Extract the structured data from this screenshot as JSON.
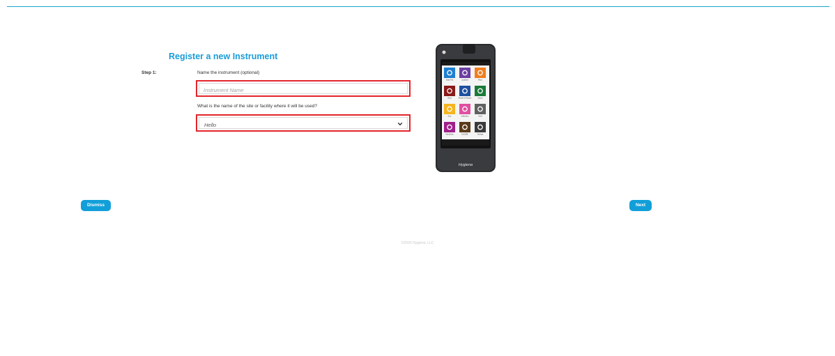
{
  "form": {
    "title": "Register a new Instrument",
    "step_label": "Step 1:",
    "name_question": "Name the instrument (optional)",
    "name_placeholder": "Instrument Name",
    "site_question": "What is the name of the site or facility where it will be used?",
    "site_selected": "Hello"
  },
  "device": {
    "brand": "Hygiena",
    "tiles": [
      {
        "label": "Swab Test",
        "icon": "lightning-icon",
        "color": "#1f7fd0"
      },
      {
        "label": "Locations",
        "icon": "location-pin-icon",
        "color": "#6c3fa0"
      },
      {
        "label": "Plans",
        "icon": "list-icon",
        "color": "#f07e1f"
      },
      {
        "label": "Users",
        "icon": "user-icon",
        "color": "#8b1a1a"
      },
      {
        "label": "Results & Reports",
        "icon": "pie-chart-icon",
        "color": "#1f4fa0"
      },
      {
        "label": "Search",
        "icon": "search-icon",
        "color": "#1a7a3a"
      },
      {
        "label": "Sync",
        "icon": "sync-icon",
        "color": "#f5b520"
      },
      {
        "label": "Calibration",
        "icon": "check-icon",
        "color": "#e04fa0"
      },
      {
        "label": "Verify",
        "icon": "verify-icon",
        "color": "#606060"
      },
      {
        "label": "MicroSnap",
        "icon": "microsnap-icon",
        "color": "#a0208a"
      },
      {
        "label": "EnSURE",
        "icon": "dots-icon",
        "color": "#5a3a1a"
      },
      {
        "label": "Settings",
        "icon": "gear-icon",
        "color": "#3a3a3a"
      }
    ]
  },
  "buttons": {
    "dismiss": "Dismiss",
    "next": "Next"
  },
  "footer": {
    "copyright": "©2020 Hygiena, LLC"
  }
}
